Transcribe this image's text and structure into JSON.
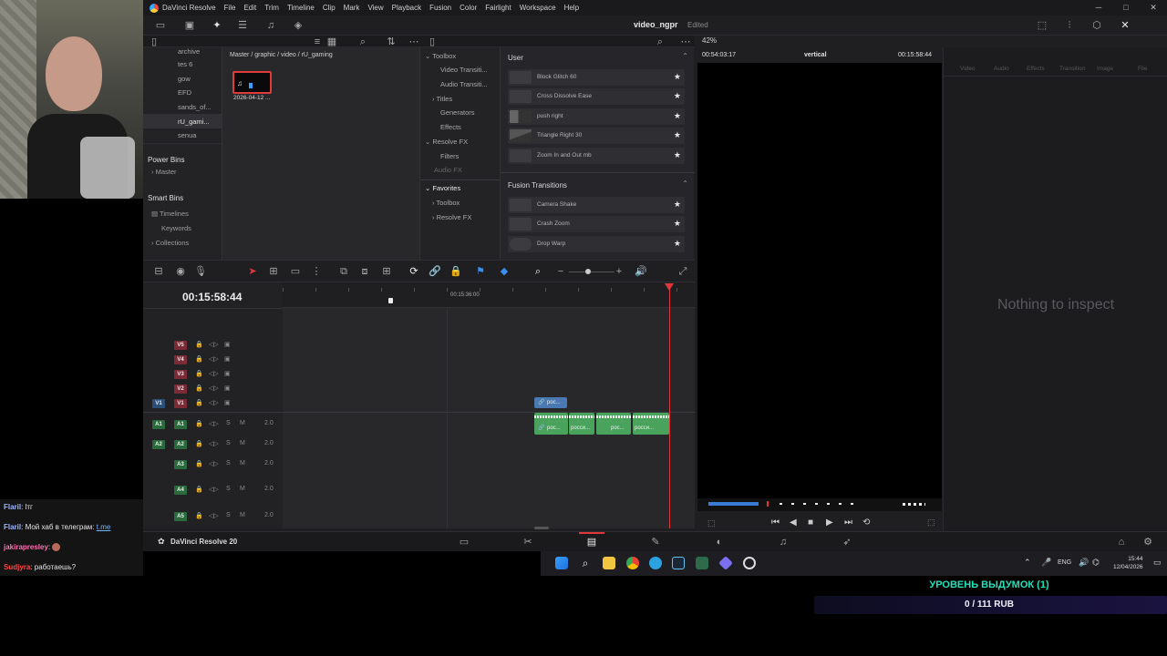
{
  "app": {
    "name": "DaVinci Resolve",
    "footer_name": "DaVinci Resolve 20",
    "menu": [
      "File",
      "Edit",
      "Trim",
      "Timeline",
      "Clip",
      "Mark",
      "View",
      "Playback",
      "Fusion",
      "Color",
      "Fairlight",
      "Workspace",
      "Help"
    ],
    "project_title": "video_ngpr",
    "project_status": "Edited",
    "zoom": "42%"
  },
  "media_pool": {
    "bins": [
      "archive",
      "tes 6",
      "gow",
      "EFD",
      "sands_of...",
      "rU_gami...",
      "senua"
    ],
    "selected_bin": "rU_gami...",
    "breadcrumb": "Master / graphic / video / rU_gaming",
    "clip_label": "2026-04-12 ...",
    "power_bins_title": "Power Bins",
    "power_bins_items": [
      "Master"
    ],
    "smart_bins_title": "Smart Bins",
    "smart_bins_items": [
      "Timelines",
      "Keywords",
      "Collections"
    ]
  },
  "effects": {
    "tree": [
      "Toolbox",
      "Video Transiti...",
      "Audio Transiti...",
      "Titles",
      "Generators",
      "Effects",
      "Resolve FX",
      "Filters",
      "Audio FX"
    ],
    "favorites_title": "Favorites",
    "favorites_tree": [
      "Toolbox",
      "Resolve FX"
    ],
    "user_title": "User",
    "user_items": [
      "Block Glitch 60",
      "Cross Dissolve Ease",
      "push right",
      "Triangle Right 30",
      "Zoom In and Out mb"
    ],
    "fusion_title": "Fusion Transitions",
    "fusion_items": [
      "Camera Shake",
      "Crash Zoom",
      "Drop Warp"
    ]
  },
  "viewer": {
    "timecode_left": "00:54:03:17",
    "name": "vertical",
    "timecode_right": "00:15:58:44"
  },
  "inspector": {
    "tabs": [
      "Video",
      "Audio",
      "Effects",
      "Transition",
      "Image",
      "File"
    ],
    "empty_text": "Nothing to inspect"
  },
  "timeline": {
    "timecode": "00:15:58:44",
    "ruler_mark": "00:15:36:00",
    "video_tracks": [
      "V5",
      "V4",
      "V3",
      "V2",
      "V1"
    ],
    "audio_tracks": [
      {
        "name": "A1",
        "level": "2.0"
      },
      {
        "name": "A2",
        "level": "2.0"
      },
      {
        "name": "A3",
        "level": "2.0"
      },
      {
        "name": "A4",
        "level": "2.0"
      },
      {
        "name": "A5",
        "level": "2.0"
      }
    ],
    "source_video": "V1",
    "source_audio": [
      "A1",
      "A2"
    ],
    "video_clip_label": "рос...",
    "audio_clip_labels": [
      "рос...",
      "росси...",
      "рос...",
      "росси..."
    ]
  },
  "chat": [
    {
      "user": "Flaril",
      "text": "lтг",
      "color": "#9fb7ff"
    },
    {
      "user": "Flaril",
      "text": "Мой хаб в телеграм: ",
      "link": "t.me",
      "color": "#9fb7ff"
    },
    {
      "user": "jakirapresley",
      "text": "",
      "color": "#ff6fb0"
    },
    {
      "user": "Sudjyra",
      "text": "работаешь?",
      "color": "#ff4444"
    }
  ],
  "taskbar": {
    "lang": "ENG",
    "time": "15:44",
    "date": "12/04/2026"
  },
  "donation": {
    "title": "УРОВЕНЬ ВЫДУМОК (1)",
    "amount": "0 / 111 RUB"
  }
}
